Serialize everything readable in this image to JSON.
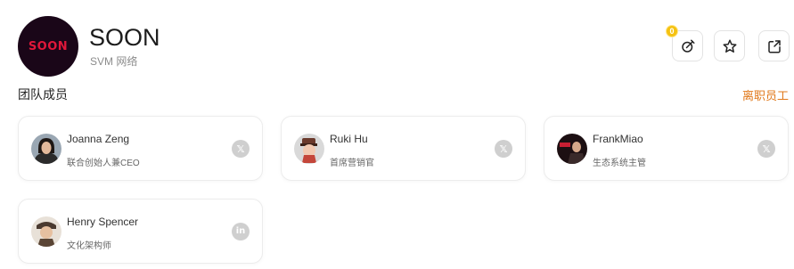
{
  "project": {
    "logo_text": "SOON",
    "title": "SOON",
    "subtitle": "SVM 网络"
  },
  "actions": {
    "badge_count": "0",
    "buttons": [
      {
        "icon": "edit-icon"
      },
      {
        "icon": "star-icon"
      },
      {
        "icon": "share-icon"
      }
    ]
  },
  "team": {
    "title": "团队成员",
    "former_link": "离职员工",
    "members": [
      {
        "name": "Joanna Zeng",
        "role": "联合创始人兼CEO",
        "social": "x-icon"
      },
      {
        "name": "Ruki Hu",
        "role": "首席营销官",
        "social": "x-icon"
      },
      {
        "name": "FrankMiao",
        "role": "生态系统主管",
        "social": "x-icon"
      },
      {
        "name": "Henry Spencer",
        "role": "文化架构师",
        "social": "linkedin-icon"
      }
    ]
  },
  "colors": {
    "accent": "#e0781a",
    "badge": "#f5c211",
    "logo_bg": "#1a0618",
    "logo_text": "#e0173a"
  }
}
